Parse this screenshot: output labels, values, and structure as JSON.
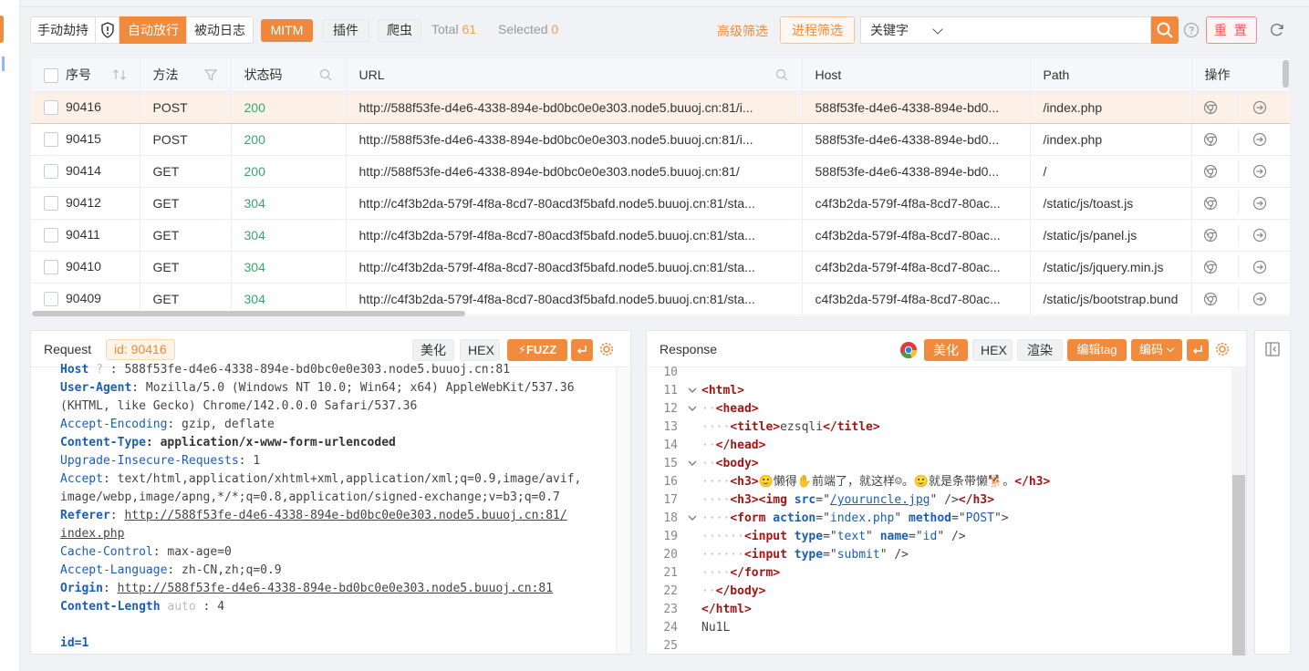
{
  "toolbar": {
    "manual_hijack": "手动劫持",
    "auto_release": "自动放行",
    "passive_log": "被动日志",
    "mitm": "MITM",
    "plugin": "插件",
    "crawler": "爬虫",
    "total_label": "Total",
    "total_value": "61",
    "selected_label": "Selected",
    "selected_value": "0",
    "advanced_filter": "高级筛选",
    "process_filter": "进程筛选",
    "keyword_select": "关键字",
    "keyword_input": "",
    "reset": "重 置"
  },
  "table": {
    "headers": {
      "id": "序号",
      "method": "方法",
      "status": "状态码",
      "url": "URL",
      "host": "Host",
      "path": "Path",
      "ops": "操作"
    },
    "rows": [
      {
        "id": "90416",
        "method": "POST",
        "status": "200",
        "url": "http://588f53fe-d4e6-4338-894e-bd0bc0e0e303.node5.buuoj.cn:81/i...",
        "host": "588f53fe-d4e6-4338-894e-bd0...",
        "path": "/index.php",
        "selected": true
      },
      {
        "id": "90415",
        "method": "POST",
        "status": "200",
        "url": "http://588f53fe-d4e6-4338-894e-bd0bc0e0e303.node5.buuoj.cn:81/i...",
        "host": "588f53fe-d4e6-4338-894e-bd0...",
        "path": "/index.php",
        "selected": false
      },
      {
        "id": "90414",
        "method": "GET",
        "status": "200",
        "url": "http://588f53fe-d4e6-4338-894e-bd0bc0e0e303.node5.buuoj.cn:81/",
        "host": "588f53fe-d4e6-4338-894e-bd0...",
        "path": "/",
        "selected": false
      },
      {
        "id": "90412",
        "method": "GET",
        "status": "304",
        "url": "http://c4f3b2da-579f-4f8a-8cd7-80acd3f5bafd.node5.buuoj.cn:81/sta...",
        "host": "c4f3b2da-579f-4f8a-8cd7-80ac...",
        "path": "/static/js/toast.js",
        "selected": false
      },
      {
        "id": "90411",
        "method": "GET",
        "status": "304",
        "url": "http://c4f3b2da-579f-4f8a-8cd7-80acd3f5bafd.node5.buuoj.cn:81/sta...",
        "host": "c4f3b2da-579f-4f8a-8cd7-80ac...",
        "path": "/static/js/panel.js",
        "selected": false
      },
      {
        "id": "90410",
        "method": "GET",
        "status": "304",
        "url": "http://c4f3b2da-579f-4f8a-8cd7-80acd3f5bafd.node5.buuoj.cn:81/sta...",
        "host": "c4f3b2da-579f-4f8a-8cd7-80ac...",
        "path": "/static/js/jquery.min.js",
        "selected": false
      },
      {
        "id": "90409",
        "method": "GET",
        "status": "304",
        "url": "http://c4f3b2da-579f-4f8a-8cd7-80acd3f5bafd.node5.buuoj.cn:81/sta...",
        "host": "c4f3b2da-579f-4f8a-8cd7-80ac...",
        "path": "/static/js/bootstrap.bund",
        "selected": false
      }
    ]
  },
  "request": {
    "title": "Request",
    "id_badge": "id: 90416",
    "beautify": "美化",
    "hex": "HEX",
    "fuzz": "FUZZ",
    "lines": [
      [
        {
          "t": "Host",
          "c": "hkb"
        },
        {
          "t": " ? ",
          "c": "dots"
        },
        {
          "t": ": 588f53fe-d4e6-4338-894e-bd0bc0e0e303.node5.buuoj.cn:81",
          "c": "hv"
        }
      ],
      [
        {
          "t": "User-Agent",
          "c": "hkb"
        },
        {
          "t": ": Mozilla/5.0 (Windows NT 10.0; Win64; x64) AppleWebKit/537.36",
          "c": "hv"
        }
      ],
      [
        {
          "t": "(KHTML, like Gecko) Chrome/142.0.0.0 Safari/537.36",
          "c": "hv"
        }
      ],
      [
        {
          "t": "Accept-Encoding",
          "c": "hk"
        },
        {
          "t": ": gzip, deflate",
          "c": "hv"
        }
      ],
      [
        {
          "t": "Content-Type",
          "c": "hkb"
        },
        {
          "t": ": application/x-www-form-urlencoded",
          "c": "hvb"
        }
      ],
      [
        {
          "t": "Upgrade-Insecure-Requests",
          "c": "hk"
        },
        {
          "t": ": 1",
          "c": "hv"
        }
      ],
      [
        {
          "t": "Accept",
          "c": "hk"
        },
        {
          "t": ": text/html,application/xhtml+xml,application/xml;q=0.9,image/avif,",
          "c": "hv"
        }
      ],
      [
        {
          "t": "image/webp,image/apng,*/*;q=0.8,application/signed-exchange;v=b3;q=0.7",
          "c": "hv"
        }
      ],
      [
        {
          "t": "Referer",
          "c": "hkb"
        },
        {
          "t": ": ",
          "c": "hv"
        },
        {
          "t": "http://588f53fe-d4e6-4338-894e-bd0bc0e0e303.node5.buuoj.cn:81/",
          "c": "hv ul"
        }
      ],
      [
        {
          "t": "index.php",
          "c": "hv ul"
        }
      ],
      [
        {
          "t": "Cache-Control",
          "c": "hk"
        },
        {
          "t": ": max-age=0",
          "c": "hv"
        }
      ],
      [
        {
          "t": "Accept-Language",
          "c": "hk"
        },
        {
          "t": ": zh-CN,zh;q=0.9",
          "c": "hv"
        }
      ],
      [
        {
          "t": "Origin",
          "c": "hkb"
        },
        {
          "t": ": ",
          "c": "hv"
        },
        {
          "t": "http://588f53fe-d4e6-4338-894e-bd0bc0e0e303.node5.buuoj.cn:81",
          "c": "hv ul"
        }
      ],
      [
        {
          "t": "Content-Length",
          "c": "hkb"
        },
        {
          "t": " auto ",
          "c": "dots"
        },
        {
          "t": ": 4",
          "c": "hv"
        }
      ],
      [
        {
          "t": "",
          "c": "hv"
        }
      ],
      [
        {
          "t": "id=1",
          "c": "hkb"
        }
      ]
    ]
  },
  "response": {
    "title": "Response",
    "beautify": "美化",
    "hex": "HEX",
    "render": "渲染",
    "edit_tag": "编辑tag",
    "encode": "编码",
    "lines": [
      {
        "n": "10",
        "f": "",
        "s": []
      },
      {
        "n": "11",
        "f": "v",
        "s": [
          {
            "t": "<",
            "c": "tg"
          },
          {
            "t": "html",
            "c": "tg"
          },
          {
            "t": ">",
            "c": "tg"
          }
        ]
      },
      {
        "n": "12",
        "f": "v",
        "s": [
          {
            "t": "··",
            "c": "dots"
          },
          {
            "t": "<head>",
            "c": "tg"
          }
        ]
      },
      {
        "n": "13",
        "f": "",
        "s": [
          {
            "t": "····",
            "c": "dots"
          },
          {
            "t": "<title>",
            "c": "tg"
          },
          {
            "t": "ezsqli",
            "c": "hv"
          },
          {
            "t": "</title>",
            "c": "tg"
          }
        ]
      },
      {
        "n": "14",
        "f": "",
        "s": [
          {
            "t": "··",
            "c": "dots"
          },
          {
            "t": "</head>",
            "c": "tg"
          }
        ]
      },
      {
        "n": "15",
        "f": "v",
        "s": [
          {
            "t": "··",
            "c": "dots"
          },
          {
            "t": "<body>",
            "c": "tg"
          }
        ]
      },
      {
        "n": "16",
        "f": "",
        "s": [
          {
            "t": "····",
            "c": "dots"
          },
          {
            "t": "<h3>",
            "c": "tg"
          },
          {
            "t": "🙂懒得✋前端了，就这样☺。🙂就是条带懒🐕。",
            "c": "hv"
          },
          {
            "t": "</h3>",
            "c": "tg"
          }
        ]
      },
      {
        "n": "17",
        "f": "",
        "s": [
          {
            "t": "····",
            "c": "dots"
          },
          {
            "t": "<h3><img ",
            "c": "tg"
          },
          {
            "t": "src",
            "c": "at"
          },
          {
            "t": "=\"",
            "c": "hv"
          },
          {
            "t": "/youruncle.jpg",
            "c": "av ul"
          },
          {
            "t": "\" />",
            "c": "hv"
          },
          {
            "t": "</h3>",
            "c": "tg"
          }
        ]
      },
      {
        "n": "18",
        "f": "v",
        "s": [
          {
            "t": "····",
            "c": "dots"
          },
          {
            "t": "<form ",
            "c": "tg"
          },
          {
            "t": "action",
            "c": "at"
          },
          {
            "t": "=\"",
            "c": "hv"
          },
          {
            "t": "index.php",
            "c": "av"
          },
          {
            "t": "\" ",
            "c": "hv"
          },
          {
            "t": "method",
            "c": "at"
          },
          {
            "t": "=\"",
            "c": "hv"
          },
          {
            "t": "POST",
            "c": "av"
          },
          {
            "t": "\">",
            "c": "hv"
          }
        ]
      },
      {
        "n": "19",
        "f": "",
        "s": [
          {
            "t": "······",
            "c": "dots"
          },
          {
            "t": "<input ",
            "c": "tg"
          },
          {
            "t": "type",
            "c": "at"
          },
          {
            "t": "=\"",
            "c": "hv"
          },
          {
            "t": "text",
            "c": "av"
          },
          {
            "t": "\" ",
            "c": "hv"
          },
          {
            "t": "name",
            "c": "at"
          },
          {
            "t": "=\"",
            "c": "hv"
          },
          {
            "t": "id",
            "c": "av"
          },
          {
            "t": "\" />",
            "c": "hv"
          }
        ]
      },
      {
        "n": "20",
        "f": "",
        "s": [
          {
            "t": "······",
            "c": "dots"
          },
          {
            "t": "<input ",
            "c": "tg"
          },
          {
            "t": "type",
            "c": "at"
          },
          {
            "t": "=\"",
            "c": "hv"
          },
          {
            "t": "submit",
            "c": "av"
          },
          {
            "t": "\" />",
            "c": "hv"
          }
        ]
      },
      {
        "n": "21",
        "f": "",
        "s": [
          {
            "t": "····",
            "c": "dots"
          },
          {
            "t": "</form>",
            "c": "tg"
          }
        ]
      },
      {
        "n": "22",
        "f": "",
        "s": [
          {
            "t": "··",
            "c": "dots"
          },
          {
            "t": "</body>",
            "c": "tg"
          }
        ]
      },
      {
        "n": "23",
        "f": "",
        "s": [
          {
            "t": "</html>",
            "c": "tg"
          }
        ]
      },
      {
        "n": "24",
        "f": "",
        "s": [
          {
            "t": "Nu1L",
            "c": "hv"
          }
        ]
      },
      {
        "n": "25",
        "f": "",
        "s": []
      }
    ]
  },
  "colors": {
    "accent": "#f08a3c",
    "status_ok": "#35a86b",
    "tag": "#a31515",
    "attr": "#1a5fb4"
  }
}
